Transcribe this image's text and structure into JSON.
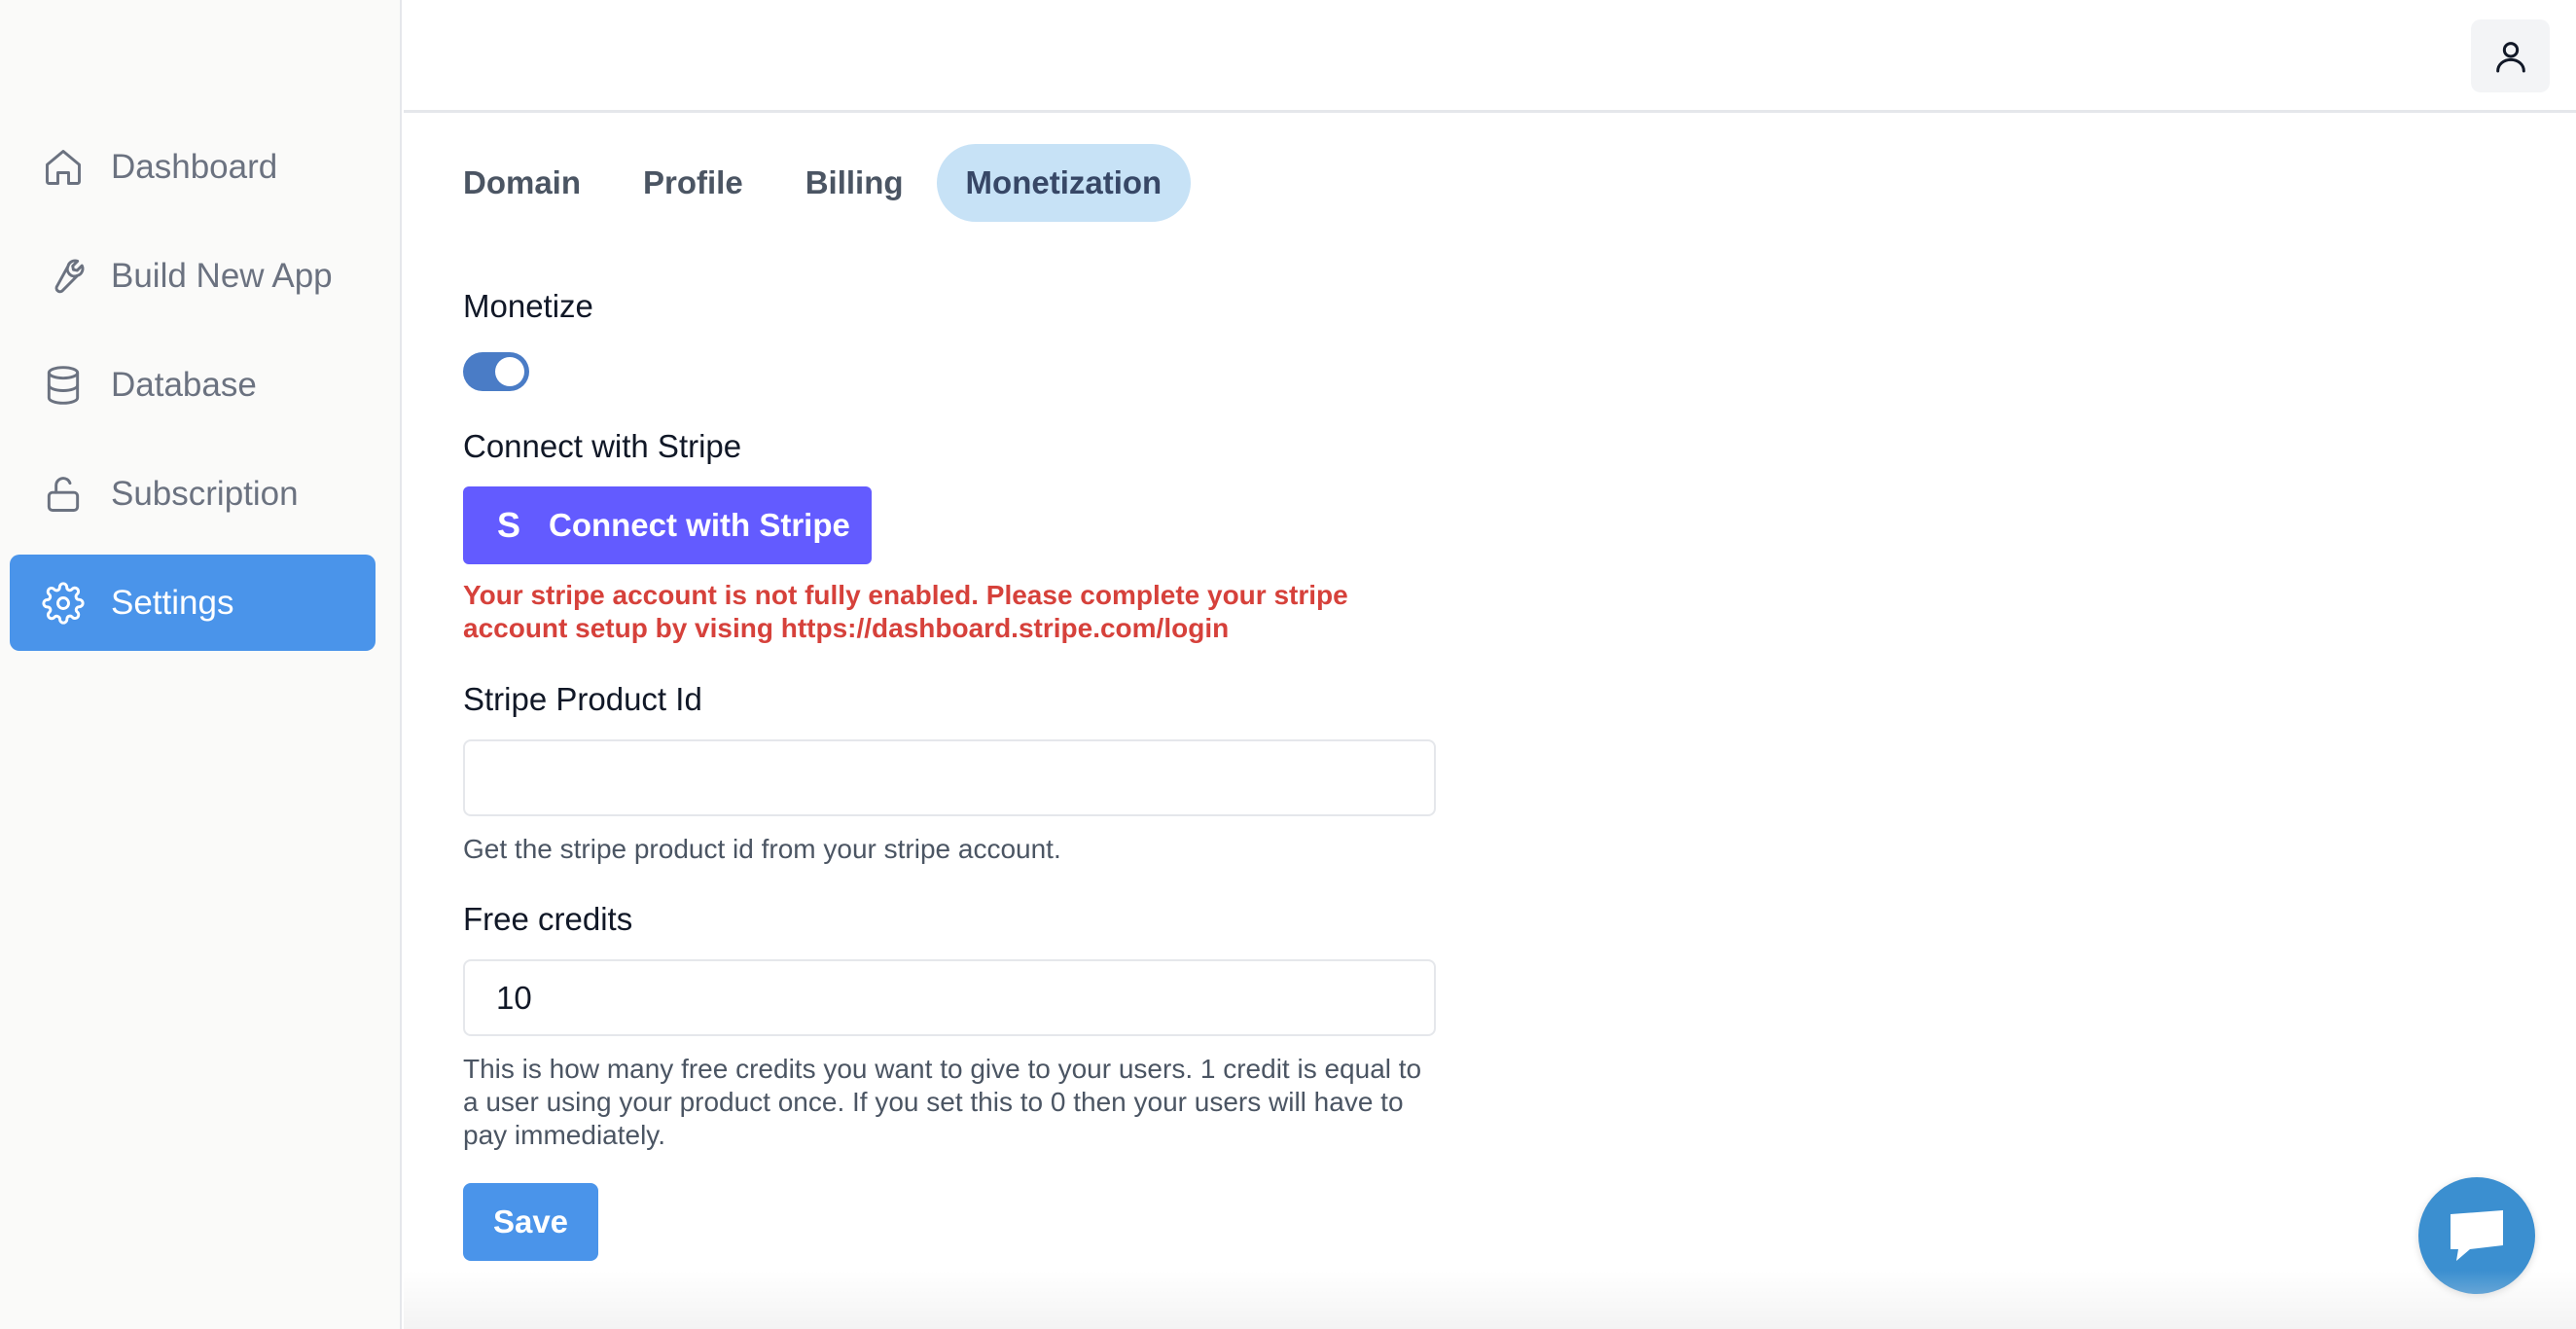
{
  "sidebar": {
    "items": [
      {
        "label": "Dashboard",
        "icon": "home-icon"
      },
      {
        "label": "Build New App",
        "icon": "wrench-icon"
      },
      {
        "label": "Database",
        "icon": "database-icon"
      },
      {
        "label": "Subscription",
        "icon": "unlock-icon"
      },
      {
        "label": "Settings",
        "icon": "gear-icon",
        "active": true
      }
    ]
  },
  "header": {
    "user_icon": "user-icon"
  },
  "tabs": [
    {
      "label": "Domain"
    },
    {
      "label": "Profile"
    },
    {
      "label": "Billing"
    },
    {
      "label": "Monetization",
      "active": true
    }
  ],
  "form": {
    "monetize_label": "Monetize",
    "monetize_enabled": true,
    "connect_label": "Connect with Stripe",
    "connect_button": "Connect with Stripe",
    "stripe_error": "Your stripe account is not fully enabled. Please complete your stripe account setup by vising https://dashboard.stripe.com/login",
    "product_id_label": "Stripe Product Id",
    "product_id_value": "",
    "product_id_help": "Get the stripe product id from your stripe account.",
    "free_credits_label": "Free credits",
    "free_credits_value": "10",
    "free_credits_help": "This is how many free credits you want to give to your users. 1 credit is equal to a user using your product once. If you set this to 0 then your users will have to pay immediately.",
    "save_button": "Save"
  },
  "colors": {
    "accent": "#4a94ea",
    "stripe": "#635bff",
    "error": "#d6413b",
    "tab_active_bg": "#c7e2f6",
    "chat": "#3b8fd0"
  }
}
